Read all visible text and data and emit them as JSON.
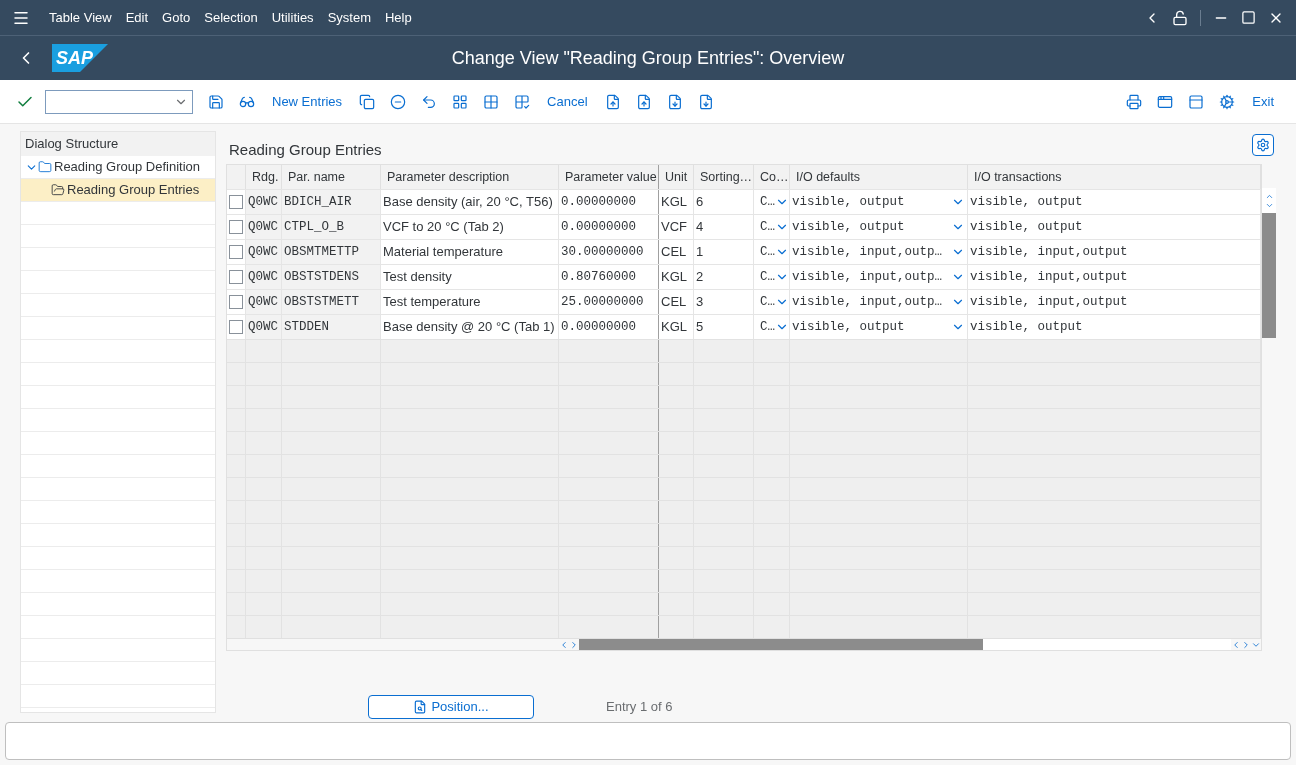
{
  "menu_bar": {
    "items": [
      "Table View",
      "Edit",
      "Goto",
      "Selection",
      "Utilities",
      "System",
      "Help"
    ]
  },
  "title_bar": {
    "logo": "SAP",
    "title": "Change View \"Reading Group Entries\": Overview"
  },
  "toolbar": {
    "text_buttons": [
      "New Entries",
      "Cancel"
    ],
    "exit_button": "Exit"
  },
  "dialog_structure": {
    "title": "Dialog Structure",
    "tree": [
      {
        "label": "Reading Group Definition",
        "expanded": true,
        "selected": false,
        "children": [
          {
            "label": "Reading Group Entries",
            "selected": true
          }
        ]
      }
    ]
  },
  "table": {
    "title": "Reading Group Entries",
    "columns": [
      "Rdg.",
      "Par. name",
      "Parameter description",
      "Parameter value",
      "Unit",
      "Sorting…",
      "Co…",
      "I/O defaults",
      "I/O transactions"
    ],
    "rows": [
      {
        "checked": false,
        "cells": [
          "Q0WC",
          "BDICH_AIR",
          "Base density (air, 20 °C, T56)",
          "0.00000000",
          "KGL",
          "6",
          "C…",
          "visible, output",
          "visible, output"
        ]
      },
      {
        "checked": false,
        "cells": [
          "Q0WC",
          "CTPL_O_B",
          "VCF to 20 °C (Tab 2)",
          "0.00000000",
          "VCF",
          "4",
          "C…",
          "visible, output",
          "visible, output"
        ]
      },
      {
        "checked": false,
        "cells": [
          "Q0WC",
          "OBSMTMETTP",
          "Material temperature",
          "30.00000000",
          "CEL",
          "1",
          "C…",
          "visible, input,outp…",
          "visible, input,output"
        ]
      },
      {
        "checked": false,
        "cells": [
          "Q0WC",
          "OBSTSTDENS",
          "Test density",
          "0.80760000",
          "KGL",
          "2",
          "C…",
          "visible, input,outp…",
          "visible, input,output"
        ]
      },
      {
        "checked": false,
        "cells": [
          "Q0WC",
          "OBSTSTMETT",
          "Test temperature",
          "25.00000000",
          "CEL",
          "3",
          "C…",
          "visible, input,outp…",
          "visible, input,output"
        ]
      },
      {
        "checked": false,
        "cells": [
          "Q0WC",
          "STDDEN",
          "Base density @ 20 °C (Tab 1)",
          "0.00000000",
          "KGL",
          "5",
          "C…",
          "visible, output",
          "visible, output"
        ]
      }
    ]
  },
  "footer": {
    "position_button": "Position...",
    "entry_count": "Entry 1 of 6"
  }
}
